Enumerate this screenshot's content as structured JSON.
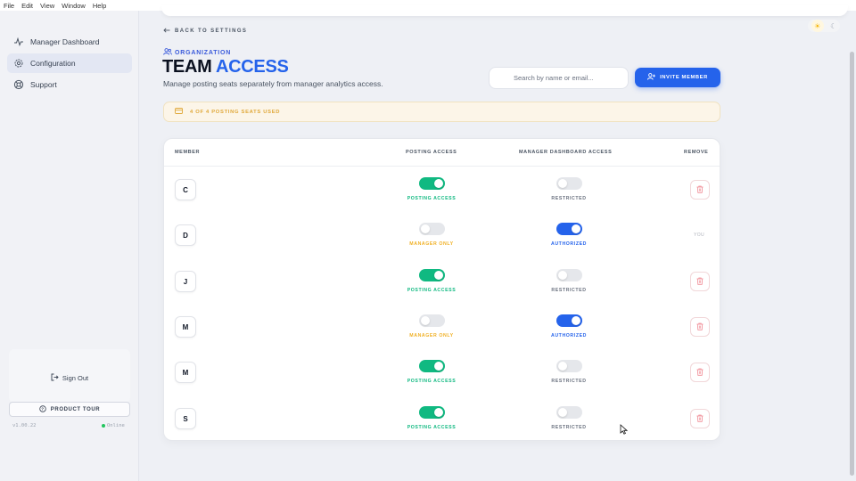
{
  "menubar": {
    "items": [
      "File",
      "Edit",
      "View",
      "Window",
      "Help"
    ]
  },
  "sidebar": {
    "items": [
      {
        "label": "Manager Dashboard",
        "icon": "activity-icon"
      },
      {
        "label": "Configuration",
        "icon": "gear-icon",
        "active": true
      },
      {
        "label": "Support",
        "icon": "lifebuoy-icon"
      }
    ],
    "sign_out": "Sign Out",
    "product_tour": "PRODUCT TOUR",
    "version": "v1.00.22",
    "status": "Online"
  },
  "header": {
    "back_link": "BACK TO SETTINGS",
    "section_label": "ORGANIZATION",
    "title_part1": "TEAM",
    "title_part2": "ACCESS",
    "subtitle": "Manage posting seats separately from manager analytics access."
  },
  "search": {
    "placeholder": "Search by name or email..."
  },
  "invite_button": "INVITE MEMBER",
  "seats_banner": "4 OF 4 POSTING SEATS USED",
  "table": {
    "columns": [
      "MEMBER",
      "POSTING ACCESS",
      "MANAGER DASHBOARD ACCESS",
      "REMOVE"
    ],
    "rows": [
      {
        "initial": "C",
        "posting_on": true,
        "posting_label": "POSTING ACCESS",
        "manager_on": false,
        "manager_label": "RESTRICTED",
        "remove": "button"
      },
      {
        "initial": "D",
        "posting_on": false,
        "posting_label": "MANAGER ONLY",
        "manager_on": true,
        "manager_label": "AUTHORIZED",
        "remove": "you",
        "you_label": "YOU"
      },
      {
        "initial": "J",
        "posting_on": true,
        "posting_label": "POSTING ACCESS",
        "manager_on": false,
        "manager_label": "RESTRICTED",
        "remove": "button"
      },
      {
        "initial": "M",
        "posting_on": false,
        "posting_label": "MANAGER ONLY",
        "manager_on": true,
        "manager_label": "AUTHORIZED",
        "remove": "button"
      },
      {
        "initial": "M",
        "posting_on": true,
        "posting_label": "POSTING ACCESS",
        "manager_on": false,
        "manager_label": "RESTRICTED",
        "remove": "button"
      },
      {
        "initial": "S",
        "posting_on": true,
        "posting_label": "POSTING ACCESS",
        "manager_on": false,
        "manager_label": "RESTRICTED",
        "remove": "button"
      }
    ]
  },
  "colors": {
    "accent": "#2563eb",
    "posting_on": "#10b981",
    "manager_only": "#f0b024",
    "restricted": "#6b7280",
    "seats_banner": "#e0a83a"
  }
}
